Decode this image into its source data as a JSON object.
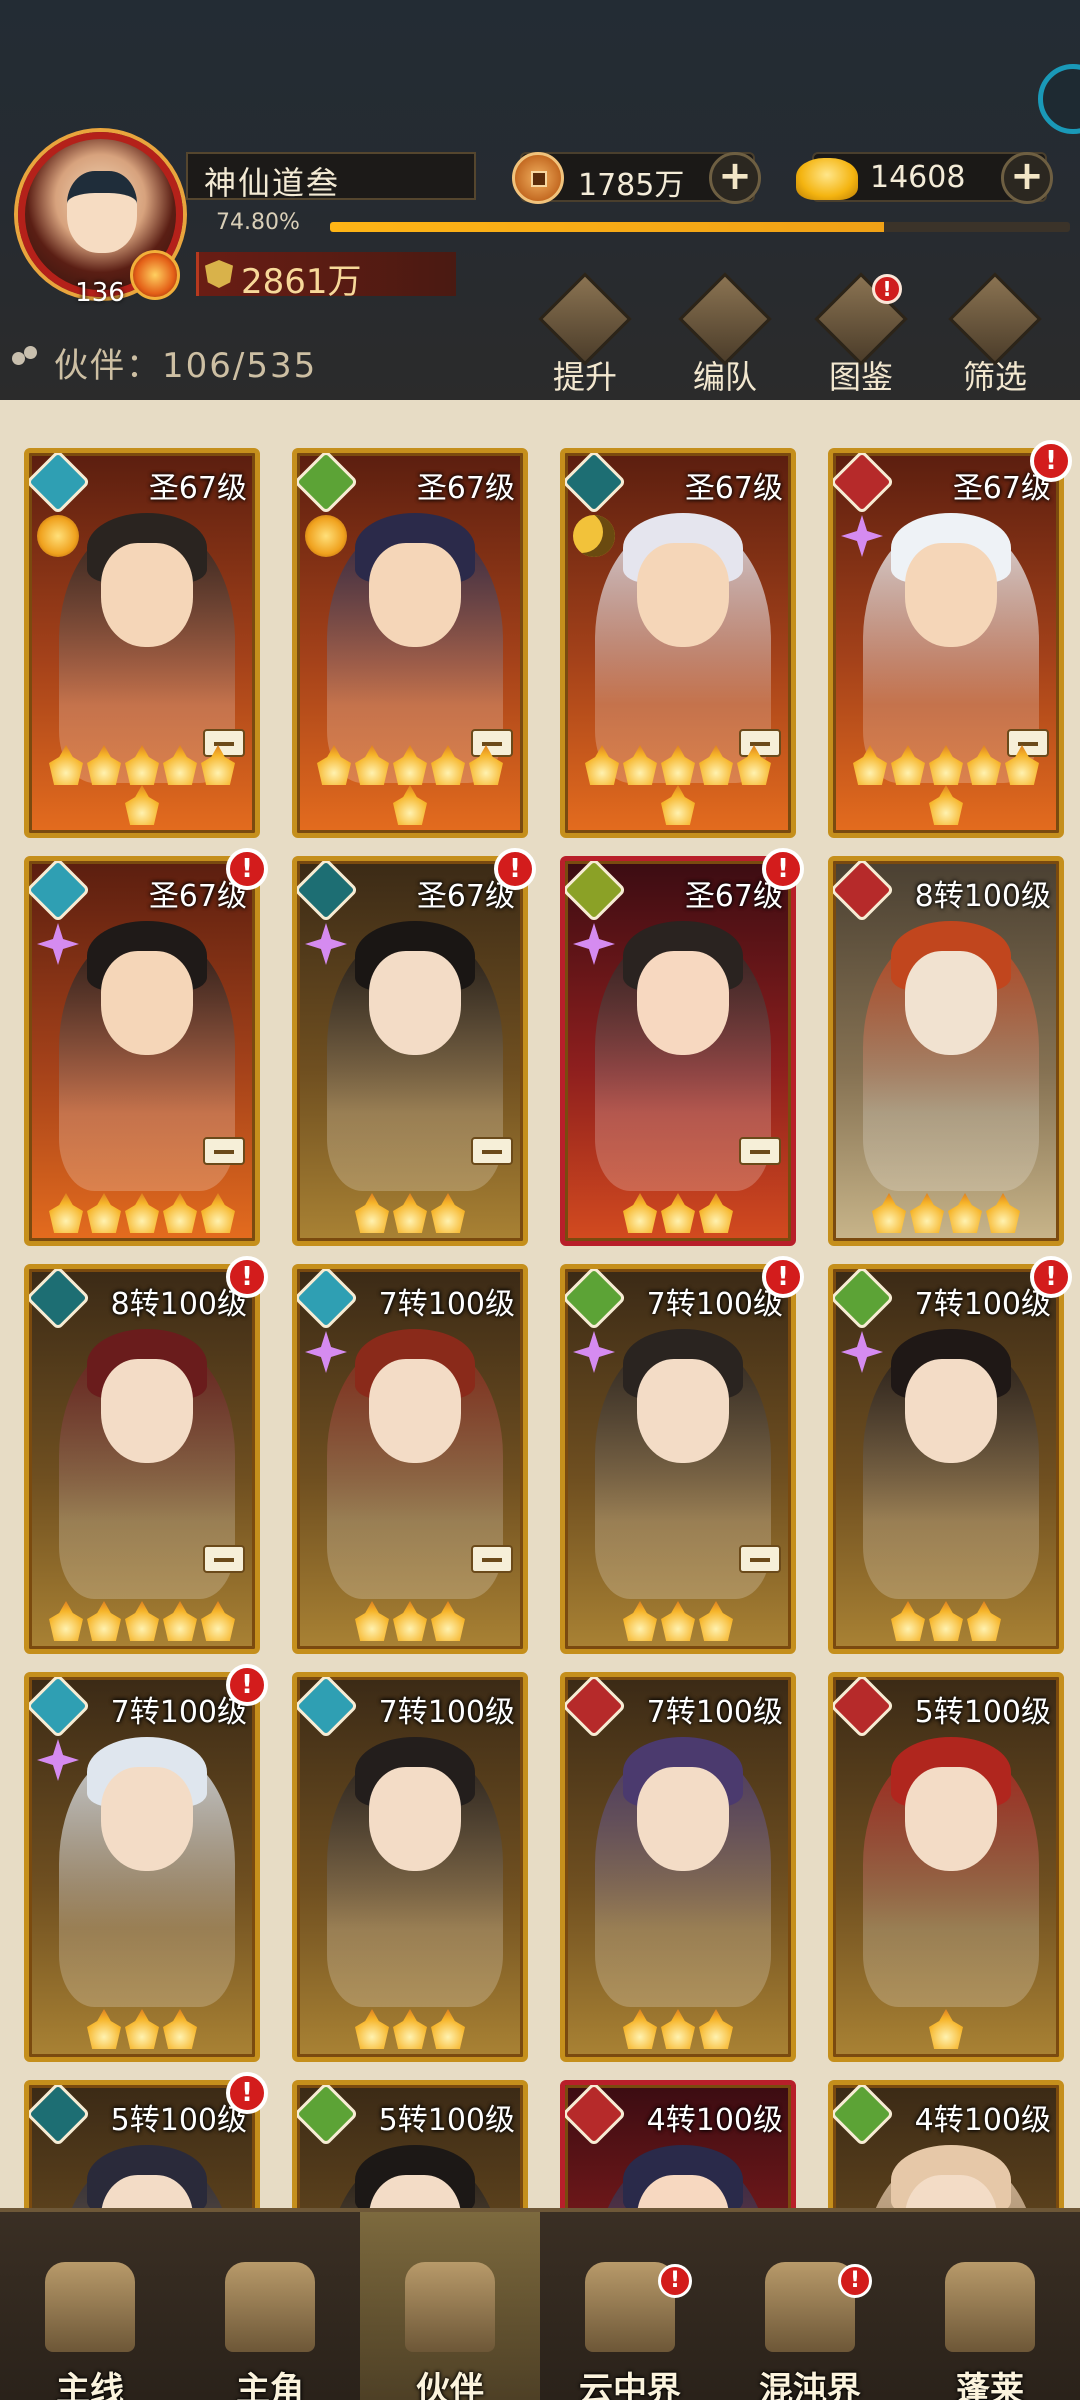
{
  "player": {
    "name": "神仙道叁",
    "level": "136",
    "exp_percent": "74.80%",
    "exp_fraction": 0.748,
    "power": "2861万"
  },
  "resources": {
    "copper": "1785万",
    "gold": "14608",
    "plus_label": "+"
  },
  "partner_count": "伙伴：106/535",
  "toolbar": [
    {
      "label": "提升",
      "icon": "upgrade-arrow-icon",
      "alert": false
    },
    {
      "label": "编队",
      "icon": "formation-flag-icon",
      "alert": true
    },
    {
      "label": "图鉴",
      "icon": "scroll-book-icon",
      "alert": true
    },
    {
      "label": "筛选",
      "icon": "filter-diamond-icon",
      "alert": false
    }
  ],
  "alert_glyph": "!",
  "partners": [
    {
      "level": "圣67级",
      "element": "water",
      "sub": "sun",
      "stars": 6,
      "frame": "legend",
      "gear": true,
      "alert": false,
      "hair": "#2a2420"
    },
    {
      "level": "圣67级",
      "element": "wood",
      "sub": "sun",
      "stars": 6,
      "frame": "legend",
      "gear": true,
      "alert": false,
      "hair": "#2b2a4a"
    },
    {
      "level": "圣67级",
      "element": "dark",
      "sub": "moon",
      "stars": 6,
      "frame": "legend",
      "gear": true,
      "alert": false,
      "hair": "#e5e5ee"
    },
    {
      "level": "圣67级",
      "element": "fire",
      "sub": "star",
      "stars": 6,
      "frame": "legend",
      "gear": true,
      "alert": true,
      "hair": "#eef2f6"
    },
    {
      "level": "圣67级",
      "element": "water",
      "sub": "star",
      "stars": 5,
      "frame": "legend",
      "gear": true,
      "alert": true,
      "hair": "#1f1a18"
    },
    {
      "level": "圣67级",
      "element": "dark",
      "sub": "star",
      "stars": 3,
      "frame": "epic",
      "gear": true,
      "alert": true,
      "hair": "#1a1614"
    },
    {
      "level": "圣67级",
      "element": "light",
      "sub": "star",
      "stars": 3,
      "frame": "mythic",
      "gear": true,
      "alert": true,
      "hair": "#2a2320"
    },
    {
      "level": "8转100级",
      "element": "fire",
      "sub": "",
      "stars": 4,
      "frame": "silver",
      "gear": false,
      "alert": false,
      "hair": "#c1461e"
    },
    {
      "level": "8转100级",
      "element": "dark",
      "sub": "",
      "stars": 5,
      "frame": "epic",
      "gear": true,
      "alert": true,
      "hair": "#6a1c1c"
    },
    {
      "level": "7转100级",
      "element": "water",
      "sub": "star",
      "stars": 3,
      "frame": "epic",
      "gear": true,
      "alert": false,
      "hair": "#8a2a1a"
    },
    {
      "level": "7转100级",
      "element": "wood",
      "sub": "star",
      "stars": 3,
      "frame": "epic",
      "gear": true,
      "alert": true,
      "hair": "#2a2420"
    },
    {
      "level": "7转100级",
      "element": "wood",
      "sub": "star",
      "stars": 3,
      "frame": "epic",
      "gear": false,
      "alert": true,
      "hair": "#1f1816"
    },
    {
      "level": "7转100级",
      "element": "water",
      "sub": "star",
      "stars": 3,
      "frame": "epic",
      "gear": false,
      "alert": true,
      "hair": "#dfe6ee"
    },
    {
      "level": "7转100级",
      "element": "water",
      "sub": "",
      "stars": 3,
      "frame": "epic",
      "gear": false,
      "alert": false,
      "hair": "#231e1c"
    },
    {
      "level": "7转100级",
      "element": "fire",
      "sub": "",
      "stars": 3,
      "frame": "epic",
      "gear": false,
      "alert": false,
      "hair": "#4b3a6e"
    },
    {
      "level": "5转100级",
      "element": "fire",
      "sub": "",
      "stars": 1,
      "frame": "epic",
      "gear": false,
      "alert": false,
      "hair": "#b0261e"
    },
    {
      "level": "5转100级",
      "element": "dark",
      "sub": "",
      "stars": 0,
      "frame": "epic",
      "gear": false,
      "alert": true,
      "hair": "#2a2a3a"
    },
    {
      "level": "5转100级",
      "element": "wood",
      "sub": "",
      "stars": 0,
      "frame": "epic",
      "gear": false,
      "alert": false,
      "hair": "#1c1816"
    },
    {
      "level": "4转100级",
      "element": "fire",
      "sub": "",
      "stars": 0,
      "frame": "mythic",
      "gear": false,
      "alert": false,
      "hair": "#2a2a4a"
    },
    {
      "level": "4转100级",
      "element": "wood",
      "sub": "",
      "stars": 0,
      "frame": "epic",
      "gear": false,
      "alert": false,
      "hair": "#e6c8a8"
    }
  ],
  "nav": [
    {
      "label": "主线",
      "icon": "main-quest-swords-icon",
      "active": false,
      "alert": false
    },
    {
      "label": "主角",
      "icon": "hero-portrait-icon",
      "active": false,
      "alert": false
    },
    {
      "label": "伙伴",
      "icon": "partner-crown-icon",
      "active": true,
      "alert": false
    },
    {
      "label": "云中界",
      "icon": "cloud-realm-temple-icon",
      "active": false,
      "alert": true
    },
    {
      "label": "混沌界",
      "icon": "chaos-realm-tower-icon",
      "active": false,
      "alert": true
    },
    {
      "label": "蓬莱",
      "icon": "penglai-sage-icon",
      "active": false,
      "alert": false
    }
  ],
  "colors": {
    "exp_bar": "#f0a116",
    "alert_red": "#d31c1c",
    "frame_gold": "#c58f1c"
  }
}
